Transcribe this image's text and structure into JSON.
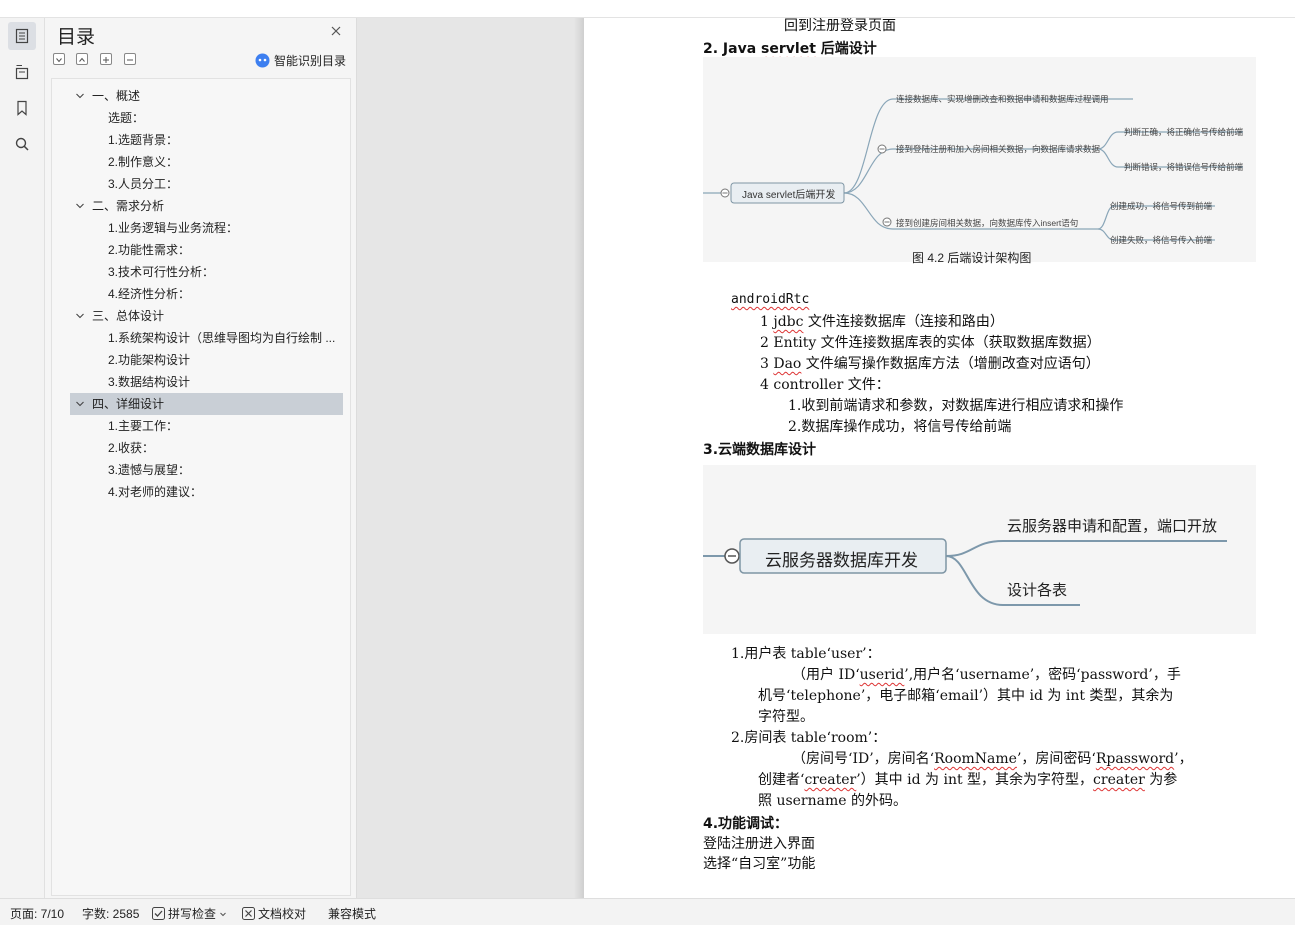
{
  "topbar": {
    "items": [
      "",
      "",
      "",
      "",
      "",
      "",
      "",
      "",
      ""
    ]
  },
  "toc": {
    "title": "目录",
    "smart_label": "智能识别目录",
    "items": [
      {
        "label": "一、概述",
        "level": 1
      },
      {
        "label": "选题：",
        "level": 2
      },
      {
        "label": "1.选题背景：",
        "level": 2
      },
      {
        "label": "2.制作意义：",
        "level": 2
      },
      {
        "label": "3.人员分工：",
        "level": 2
      },
      {
        "label": "二、需求分析",
        "level": 1
      },
      {
        "label": "1.业务逻辑与业务流程：",
        "level": 2
      },
      {
        "label": "2.功能性需求：",
        "level": 2
      },
      {
        "label": "3.技术可行性分析：",
        "level": 2
      },
      {
        "label": "4.经济性分析：",
        "level": 2
      },
      {
        "label": "三、总体设计",
        "level": 1
      },
      {
        "label": "1.系统架构设计（思维导图均为自行绘制 ...",
        "level": 2
      },
      {
        "label": "2.功能架构设计",
        "level": 2
      },
      {
        "label": "3.数据结构设计",
        "level": 2
      },
      {
        "label": "四、详细设计",
        "level": 1,
        "selected": true
      },
      {
        "label": "1.主要工作：",
        "level": 2
      },
      {
        "label": "2.收获：",
        "level": 2
      },
      {
        "label": "3.遗憾与展望：",
        "level": 2
      },
      {
        "label": "4.对老师的建议：",
        "level": 2
      }
    ]
  },
  "doc": {
    "line_top": "回到注册登录页面",
    "h2_prefix": "2. Java ",
    "h2_squig": "servlet",
    "h2_suffix": " 后端设计",
    "fig1": {
      "root": "Java servlet后端开发",
      "b1": "连接数据库、实现增删改查和数据申请和数据库过程调用",
      "b2": "接到登陆注册和加入房间相关数据，向数据库请求数据",
      "b2a": "判断正确，将正确信号传给前端",
      "b2b": "判断错误，将错误信号传给前端",
      "b3": "接到创建房间相关数据，向数据库传入insert语句",
      "b3a": "创建成功，将信号传到前端",
      "b3b": "创建失败，将信号传入前端",
      "caption": "图 4.2 后端设计架构图"
    },
    "androidrtc": "androidRtc",
    "list1": [
      {
        "num": "1 ",
        "sq": "jdbc",
        "rest": " 文件连接数据库（连接和路由）"
      },
      {
        "num": "2 ",
        "sq": "",
        "rest": "Entity 文件连接数据库表的实体（获取数据库数据）"
      },
      {
        "num": "3 ",
        "sq": "Dao",
        "rest": " 文件编写操作数据库方法（增删改查对应语句）"
      },
      {
        "num": "4 ",
        "sq": "",
        "rest": "controller 文件："
      }
    ],
    "list1_sub": [
      "1.收到前端请求和参数，对数据库进行相应请求和操作",
      "2.数据库操作成功，将信号传给前端"
    ],
    "h3": "3.云端数据库设计",
    "fig2": {
      "root": "云服务器数据库开发",
      "b1": "云服务器申请和配置，端口开放",
      "b2": "设计各表"
    },
    "user_table_head": "1.用户表 table‘user’：",
    "user_table_l1a": "（用户 ID‘",
    "user_table_l1sq": "userid",
    "user_table_l1b": "’,用户名‘username’，密码‘password’，手",
    "user_table_l2": "机号‘telephone’，电子邮箱‘email’）其中 id 为 int 类型，其余为",
    "user_table_l3": "字符型。",
    "room_table_head": "2.房间表 table‘room’：",
    "room_l1a": "（房间号‘ID’，房间名‘",
    "room_l1sq": "RoomName",
    "room_l1b": "’，房间密码‘",
    "room_l1sq2": "Rpassword",
    "room_l1c": "’，",
    "room_l2a": "创建者‘",
    "room_l2sq": "creater",
    "room_l2b": "’）其中 id 为 int 型，其余为字符型，",
    "room_l2sq2": "creater",
    "room_l2c": " 为参",
    "room_l3": "照 username 的外码。",
    "h4": "4.功能调试：",
    "p1": "登陆注册进入界面",
    "p2": "选择“自习室”功能"
  },
  "status": {
    "page": "页面: 7/10",
    "words": "字数: 2585",
    "spell": "拼写检查",
    "proof": "文档校对",
    "compat": "兼容模式"
  }
}
